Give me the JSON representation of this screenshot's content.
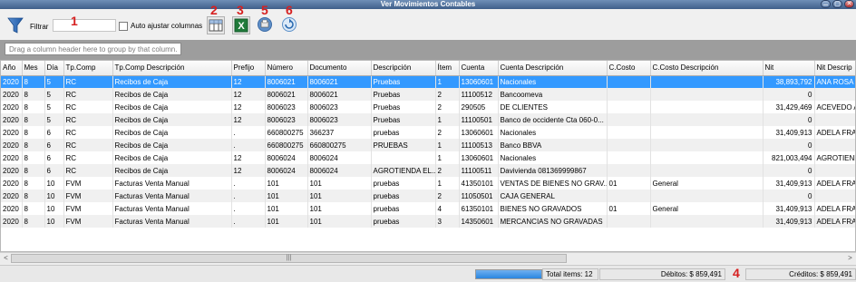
{
  "window": {
    "title": "Ver Movimientos Contables",
    "controls": [
      "⚊",
      "▢",
      "✕"
    ]
  },
  "toolbar": {
    "filter_label": "Filtrar",
    "filter_value": "",
    "auto_adjust_label": "Auto ajustar columnas",
    "auto_adjust_checked": false,
    "annotations": [
      "1",
      "2",
      "3",
      "5",
      "6",
      "4"
    ]
  },
  "groupbar": {
    "hint": "Drag a column header here to group by that column."
  },
  "grid": {
    "columns": [
      "Año",
      "Mes",
      "Día",
      "Tp.Comp",
      "Tp.Comp Descripción",
      "Prefijo",
      "Número",
      "Documento",
      "Descripción",
      "Ítem",
      "Cuenta",
      "Cuenta Descripción",
      "C.Costo",
      "C.Costo Descripción",
      "Nit",
      "Nit Descrip"
    ],
    "rows": [
      [
        "2020",
        "8",
        "5",
        "RC",
        "Recibos de Caja",
        "12",
        "8006021",
        "8006021",
        "Pruebas",
        "1",
        "13060601",
        "Nacionales",
        "",
        "",
        "38,893,792",
        "ANA ROSA"
      ],
      [
        "2020",
        "8",
        "5",
        "RC",
        "Recibos de Caja",
        "12",
        "8006021",
        "8006021",
        "Pruebas",
        "2",
        "11100512",
        "Bancoomeva",
        "",
        "",
        "0",
        ""
      ],
      [
        "2020",
        "8",
        "5",
        "RC",
        "Recibos de Caja",
        "12",
        "8006023",
        "8006023",
        "Pruebas",
        "2",
        "290505",
        "DE CLIENTES",
        "",
        "",
        "31,429,469",
        "ACEVEDO A"
      ],
      [
        "2020",
        "8",
        "5",
        "RC",
        "Recibos de Caja",
        "12",
        "8006023",
        "8006023",
        "Pruebas",
        "1",
        "11100501",
        "Banco de occidente Cta 060-0...",
        "",
        "",
        "0",
        ""
      ],
      [
        "2020",
        "8",
        "6",
        "RC",
        "Recibos de Caja",
        ".",
        "660800275",
        "366237",
        "pruebas",
        "2",
        "13060601",
        "Nacionales",
        "",
        "",
        "31,409,913",
        "ADELA FRA"
      ],
      [
        "2020",
        "8",
        "6",
        "RC",
        "Recibos de Caja",
        ".",
        "660800275",
        "660800275",
        "PRUEBAS",
        "1",
        "11100513",
        "Banco BBVA",
        "",
        "",
        "0",
        ""
      ],
      [
        "2020",
        "8",
        "6",
        "RC",
        "Recibos de Caja",
        "12",
        "8006024",
        "8006024",
        "",
        "1",
        "13060601",
        "Nacionales",
        "",
        "",
        "821,003,494",
        "AGROTIENDA"
      ],
      [
        "2020",
        "8",
        "6",
        "RC",
        "Recibos de Caja",
        "12",
        "8006024",
        "8006024",
        "AGROTIENDA EL...",
        "2",
        "11100511",
        "Davivienda 081369999867",
        "",
        "",
        "0",
        ""
      ],
      [
        "2020",
        "8",
        "10",
        "FVM",
        "Facturas Venta Manual",
        ".",
        "101",
        "101",
        "pruebas",
        "1",
        "41350101",
        "VENTAS DE BIENES NO GRAV...",
        "01",
        "General",
        "31,409,913",
        "ADELA FRA"
      ],
      [
        "2020",
        "8",
        "10",
        "FVM",
        "Facturas Venta Manual",
        ".",
        "101",
        "101",
        "pruebas",
        "2",
        "11050501",
        "CAJA GENERAL",
        "",
        "",
        "0",
        ""
      ],
      [
        "2020",
        "8",
        "10",
        "FVM",
        "Facturas Venta Manual",
        ".",
        "101",
        "101",
        "pruebas",
        "4",
        "61350101",
        "BIENES NO GRAVADOS",
        "01",
        "General",
        "31,409,913",
        "ADELA FRA"
      ],
      [
        "2020",
        "8",
        "10",
        "FVM",
        "Facturas Venta Manual",
        ".",
        "101",
        "101",
        "pruebas",
        "3",
        "14350601",
        "MERCANCIAS NO GRAVADAS",
        "",
        "",
        "31,409,913",
        "ADELA FRA"
      ]
    ],
    "selected_row": 0
  },
  "scrollbar": {
    "left_arrow": "<",
    "right_arrow": ">",
    "thumb_grip": "|||"
  },
  "status": {
    "progress_fraction": 1.0,
    "total_items": "Total items: 12",
    "debitos": "Débitos: $ 859,491",
    "creditos": "Créditos: $ 859,491"
  },
  "colors": {
    "selected_row": "#3399ff",
    "annotation_red": "#d62020",
    "titlebar": "#4f6f9a"
  },
  "icons": {
    "filter": "funnel-icon",
    "columns": "column-chooser-icon",
    "excel": "excel-export-icon",
    "print": "print-icon",
    "refresh": "refresh-icon"
  }
}
